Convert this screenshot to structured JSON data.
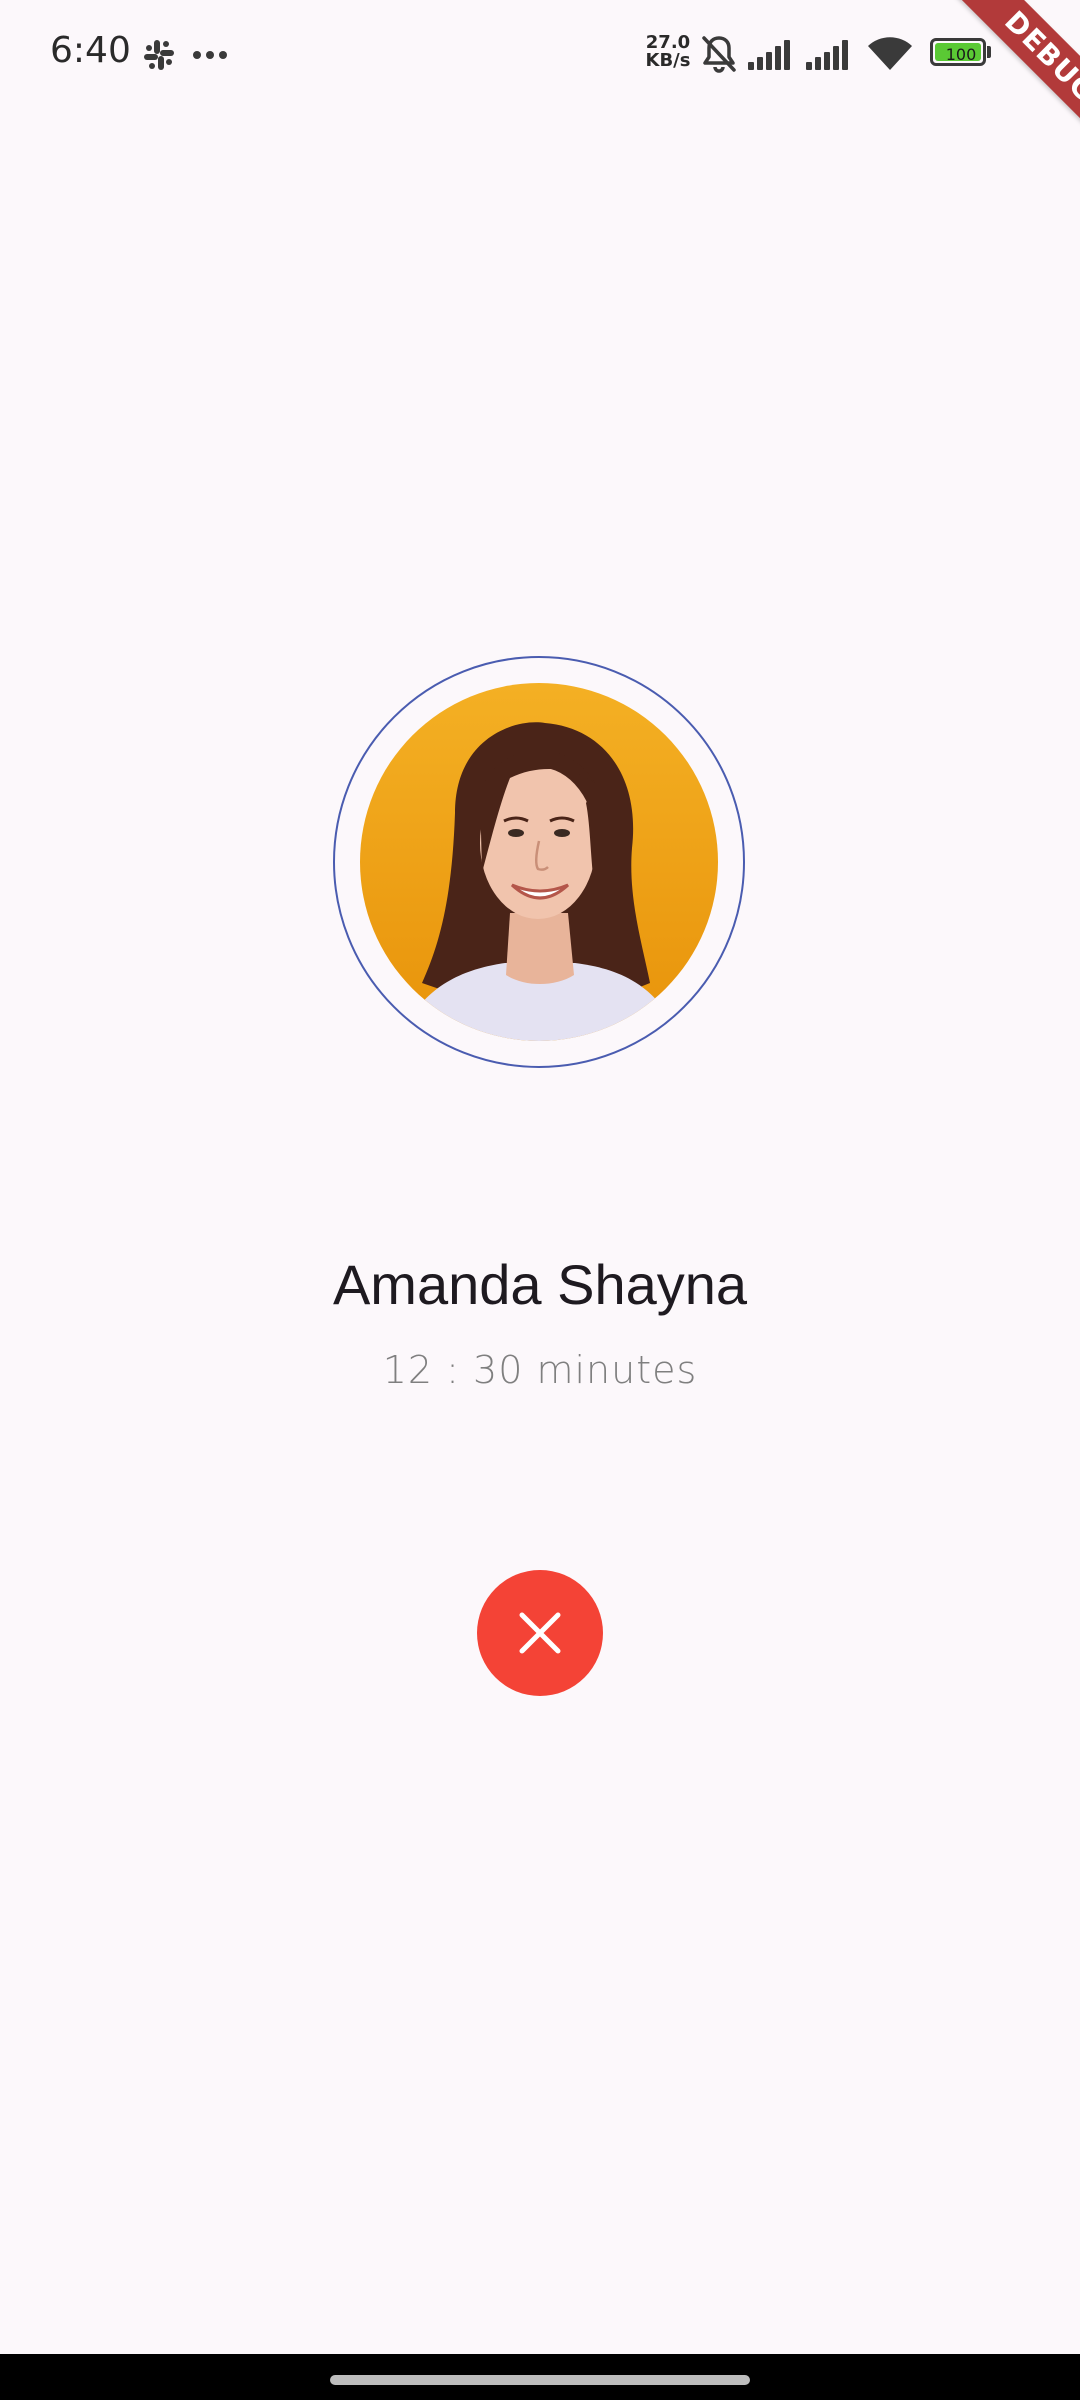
{
  "status_bar": {
    "time": "6:40",
    "net_speed_value": "27.0",
    "net_speed_unit": "KB/s",
    "battery_level": "100",
    "icons": [
      "slack-icon",
      "more-icon",
      "bell-off-icon",
      "signal-icon",
      "signal-icon",
      "wifi-icon",
      "battery-icon"
    ]
  },
  "debug_banner": "DEBUG",
  "call": {
    "caller_name": "Amanda Shayna",
    "duration": "12 : 30 minutes",
    "end_call_icon": "close-icon"
  },
  "colors": {
    "background": "#fcf8fb",
    "end_call": "#f44336",
    "avatar_ring": "#4a5cb0",
    "avatar_bg": "#f2a81f",
    "battery": "#5ac934",
    "debug_banner": "#b23a3a"
  }
}
